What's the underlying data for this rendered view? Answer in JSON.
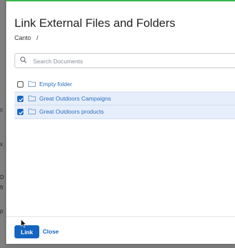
{
  "background": {
    "fragments": [
      "c",
      "x",
      "D",
      "ft",
      "p"
    ]
  },
  "modal": {
    "title": "Link External Files and Folders",
    "breadcrumb": {
      "root": "Canto",
      "separator": "/"
    },
    "search": {
      "placeholder": "Search Documents",
      "value": ""
    },
    "items": [
      {
        "label": "Empty folder",
        "checked": false
      },
      {
        "label": "Great Outdoors Campaigns",
        "checked": true
      },
      {
        "label": "Great Outdoors products",
        "checked": true
      }
    ],
    "footer": {
      "link_label": "Link",
      "close_label": "Close"
    }
  },
  "colors": {
    "accent": "#1565c0",
    "top_border": "#37b34a",
    "selected_row": "#e6eefb"
  }
}
